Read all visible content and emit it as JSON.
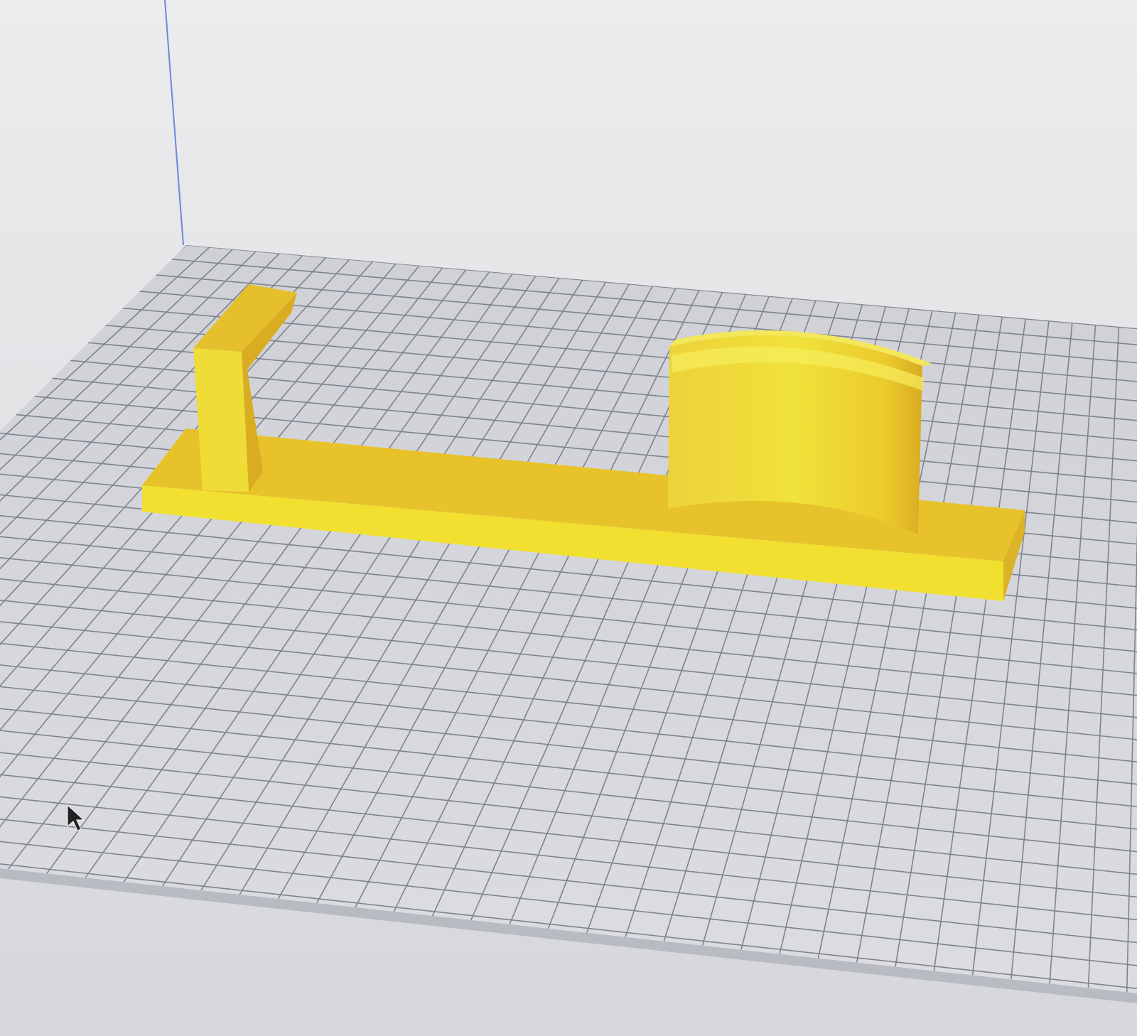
{
  "viewport": {
    "name": "3d-build-plate-view",
    "background_top": "#e8e8ea",
    "background_bottom": "#d9d9dc",
    "plate_color": "#c9cbd2",
    "grid_color": "#7f838d",
    "axis_line_color": "#4a6fd6"
  },
  "model": {
    "color_light": "#f2e030",
    "color_mid": "#e8c52a",
    "color_dark": "#d8a920",
    "parts": [
      "base-bar",
      "left-post",
      "curved-wall"
    ]
  },
  "grid": {
    "columns": 30,
    "rows": 24
  },
  "cursor": {
    "icon": "mouse-pointer-icon"
  }
}
